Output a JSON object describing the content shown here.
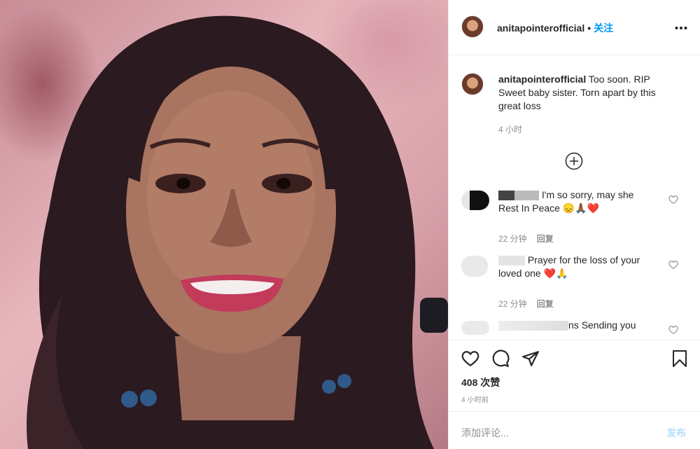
{
  "header": {
    "username": "anitapointerofficial",
    "dot": "•",
    "follow_label": "关注"
  },
  "caption": {
    "username": "anitapointerofficial",
    "text": "Too soon. RIP Sweet baby sister. Torn apart by this great loss",
    "time": "4 小时"
  },
  "comments": [
    {
      "name_partial": "",
      "text": "I'm so sorry, may she Rest In Peace",
      "emojis": "😞🙏🏾❤️",
      "time": "22 分钟",
      "reply_label": "回复"
    },
    {
      "name_partial": "",
      "text": "Prayer for the loss of your loved one",
      "emojis": "❤️🙏",
      "time": "22 分钟",
      "reply_label": "回复"
    },
    {
      "name_partial": "ns",
      "text": "Sending you"
    }
  ],
  "actions": {
    "likes": "408 次赞",
    "time": "4 小时前"
  },
  "add_comment": {
    "placeholder": "添加评论...",
    "post_label": "发布"
  },
  "colors": {
    "accent": "#0095f6",
    "post_disabled": "#b2dffc",
    "muted": "#8e8e8e"
  }
}
